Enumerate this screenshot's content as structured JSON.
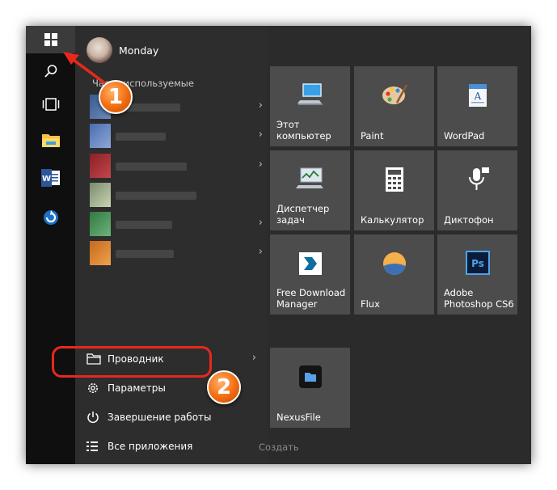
{
  "user": {
    "name": "Monday"
  },
  "left": {
    "most_used_label": "Часто используемые",
    "system": {
      "explorer": "Проводник",
      "settings": "Параметры",
      "shutdown": "Завершение работы",
      "all_apps": "Все приложения",
      "create": "Создать"
    }
  },
  "tiles": {
    "computer": {
      "line1": "Этот",
      "line2": "компьютер"
    },
    "paint": "Paint",
    "wordpad": "WordPad",
    "taskmgr": {
      "line1": "Диспетчер",
      "line2": "задач"
    },
    "calc": "Калькулятор",
    "recorder": "Диктофон",
    "fdm": {
      "line1": "Free Download",
      "line2": "Manager"
    },
    "flux": "Flux",
    "photoshop": {
      "line1": "Adobe",
      "line2": "Photoshop CS6"
    },
    "nexusfile": "NexusFile"
  },
  "annotations": {
    "step1": "1",
    "step2": "2"
  },
  "colors": {
    "accent": "#e8281b",
    "badge": "#f26b0f",
    "tile": "#4c4c4c"
  },
  "icons": [
    "windows-logo-icon",
    "search-icon",
    "task-view-icon",
    "file-explorer-icon",
    "word-icon",
    "refresh-icon",
    "settings-gear-icon",
    "power-icon",
    "all-apps-icon",
    "computer-icon",
    "paint-palette-icon",
    "wordpad-icon",
    "task-manager-icon",
    "calculator-icon",
    "microphone-icon",
    "download-arrow-icon",
    "flux-icon",
    "photoshop-icon",
    "nexusfile-icon",
    "arrow-icon"
  ]
}
